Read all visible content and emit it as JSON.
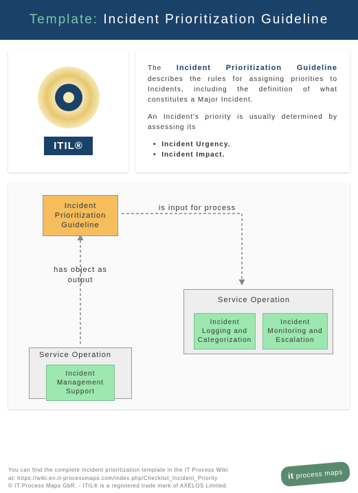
{
  "header": {
    "prefix": "Template: ",
    "title": "Incident Prioritization Guideline"
  },
  "itil_label": "ITIL®",
  "description": {
    "intro_prefix": "The ",
    "intro_bold": "Incident Prioritization Guideline",
    "intro_rest": " describes the rules for assigning priorities to Incidents, including the definition of what constitutes a Major Incident.",
    "para2": "An Incident's priority is usually determined by assessing its",
    "bullets": [
      "Incident Urgency.",
      "Incident Impact."
    ]
  },
  "diagram": {
    "main_box": "Incident Prioritization Guideline",
    "label_output": "has object as output",
    "label_input": "is input for process",
    "service_op": "Service Operation",
    "green_boxes": {
      "g1": "Incident Management Support",
      "g2": "Incident Logging and Categorization",
      "g3": "Incident Monitoring and Escalation"
    }
  },
  "footer": {
    "line1": "You can find the complete incident prioritization template in the IT Process Wiki",
    "line2": "at: https://wiki.en.it-processmaps.com/index.php/Checklist_Incident_Priority",
    "line3": "© IT Process Maps GbR. - ITIL® is a registered trade mark of AXELOS Limited.",
    "logo_it": "it",
    "logo_rest": "process maps"
  }
}
